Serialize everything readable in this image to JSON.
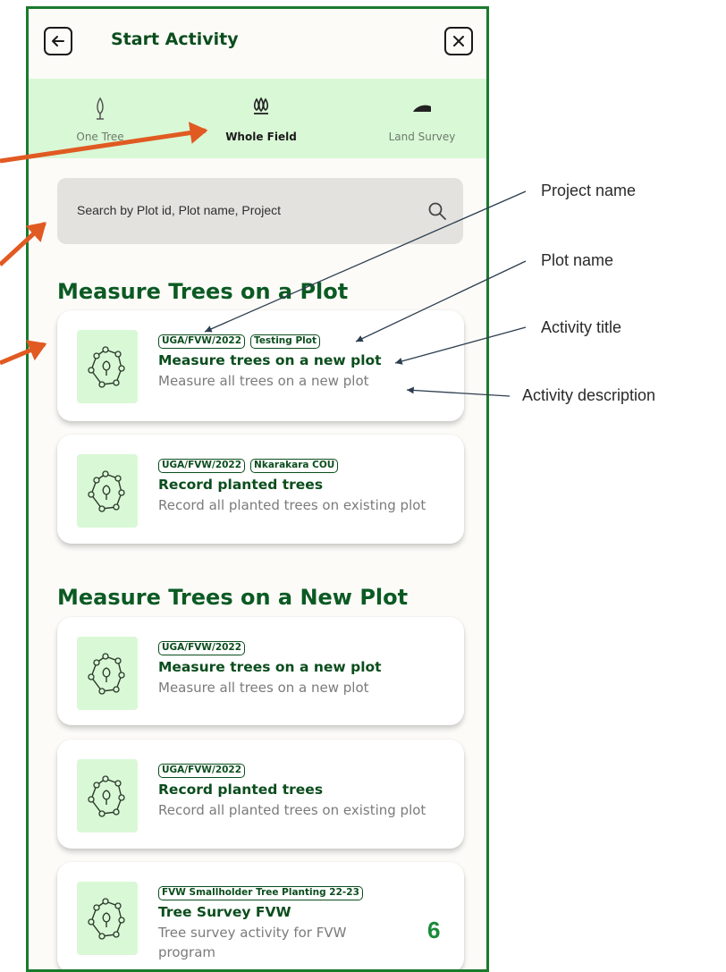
{
  "header": {
    "title": "Start Activity",
    "back_icon": "back-arrow-icon",
    "close_icon": "close-icon"
  },
  "tabs": [
    {
      "label": "One Tree",
      "icon": "single-tree-icon",
      "active": false
    },
    {
      "label": "Whole Field",
      "icon": "trees-icon",
      "active": true
    },
    {
      "label": "Land Survey",
      "icon": "land-icon",
      "active": false
    }
  ],
  "search": {
    "placeholder": "Search by Plot id, Plot name, Project",
    "icon": "search-icon"
  },
  "sections": [
    {
      "title": "Measure Trees on a Plot",
      "cards": [
        {
          "tags": [
            "UGA/FVW/2022",
            "Testing Plot"
          ],
          "title": "Measure trees on a new plot",
          "description": "Measure all trees on a new plot"
        },
        {
          "tags": [
            "UGA/FVW/2022",
            "Nkarakara COU"
          ],
          "title": "Record planted trees",
          "description": "Record all planted trees on existing plot"
        }
      ]
    },
    {
      "title": "Measure Trees on a New Plot",
      "cards": [
        {
          "tags": [
            "UGA/FVW/2022"
          ],
          "title": "Measure trees on a new plot",
          "description": "Measure all trees on a new plot"
        },
        {
          "tags": [
            "UGA/FVW/2022"
          ],
          "title": "Record planted trees",
          "description": "Record all planted trees on existing plot"
        },
        {
          "tags": [
            "FVW Smallholder Tree Planting 22-23"
          ],
          "title": "Tree Survey FVW",
          "description": "Tree survey activity for FVW program"
        }
      ]
    }
  ],
  "annotations": {
    "project_name": "Project name",
    "plot_name": "Plot name",
    "activity_title": "Activity title",
    "activity_description": "Activity description"
  },
  "page_number": "6",
  "colors": {
    "brand_green": "#0b4d1d",
    "tab_bg": "#d9f8d6",
    "frame_border": "#1a7a2e",
    "arrow_orange": "#e05a22"
  }
}
